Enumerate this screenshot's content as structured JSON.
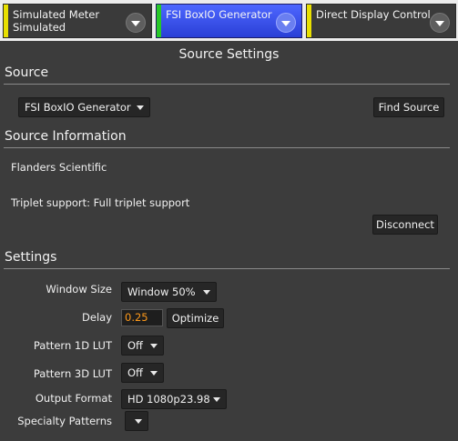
{
  "tabs": [
    {
      "label": "Simulated Meter",
      "sub": "Simulated",
      "stripe": "#e8e000"
    },
    {
      "label": "FSI BoxIO Generator",
      "sub": "",
      "stripe": "#28c828"
    },
    {
      "label": "Direct Display Control",
      "sub": "",
      "stripe": "#e8e000"
    }
  ],
  "panel_title": "Source Settings",
  "source": {
    "heading": "Source",
    "selected": "FSI BoxIO Generator",
    "find_button": "Find Source"
  },
  "source_info": {
    "heading": "Source Information",
    "manufacturer": "Flanders Scientific",
    "triplet": "Triplet support: Full triplet support",
    "disconnect_button": "Disconnect"
  },
  "settings": {
    "heading": "Settings",
    "window_size": {
      "label": "Window Size",
      "value": "Window 50%"
    },
    "delay": {
      "label": "Delay",
      "value": "0.25",
      "optimize_button": "Optimize"
    },
    "pattern_1d": {
      "label": "Pattern 1D LUT",
      "value": "Off"
    },
    "pattern_3d": {
      "label": "Pattern 3D LUT",
      "value": "Off"
    },
    "output_format": {
      "label": "Output Format",
      "value": "HD 1080p23.98"
    },
    "specialty": {
      "label": "Specialty Patterns",
      "value": ""
    }
  },
  "colors": {
    "active_tab": "#3b55ee",
    "delay_text": "#ff9a1a",
    "background": "#3c3c3c"
  }
}
